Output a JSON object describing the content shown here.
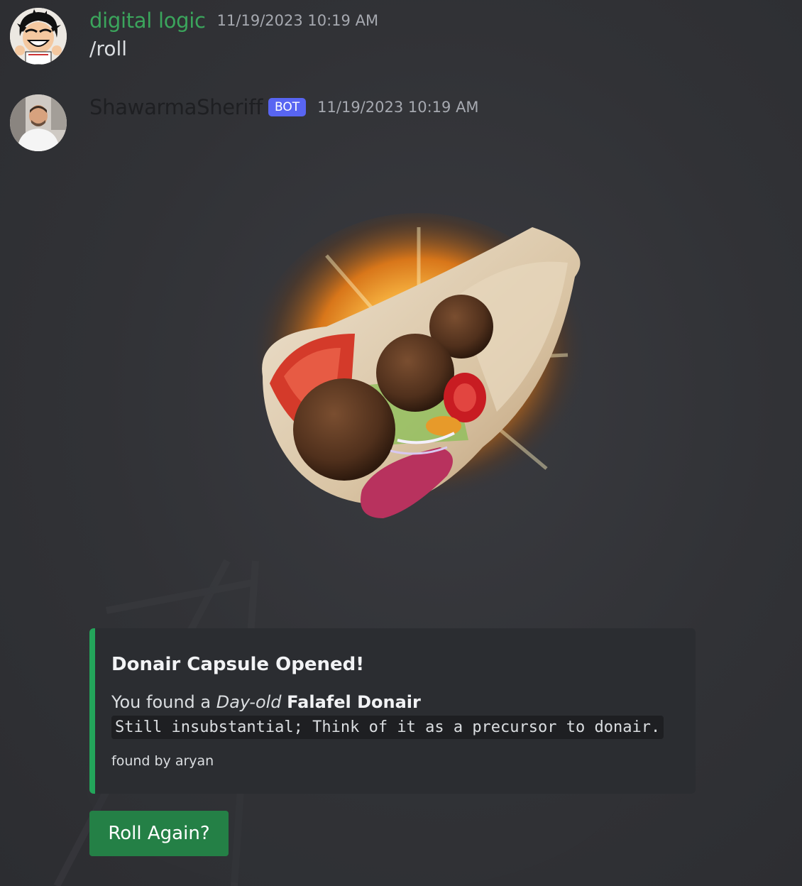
{
  "messages": [
    {
      "username": "digital logic",
      "username_color": "#3ba55c",
      "timestamp": "11/19/2023 10:19 AM",
      "content": "/roll",
      "avatar_icon": "anime-avatar"
    },
    {
      "username": "ShawarmaSheriff",
      "username_color": "#1e1f22",
      "badge": "BOT",
      "timestamp": "11/19/2023 10:19 AM",
      "avatar_icon": "person-avatar",
      "image_icon": "falafel-donair-image"
    }
  ],
  "embed": {
    "accent_color": "#23a55a",
    "title": "Donair Capsule Opened!",
    "desc_prefix": "You found a ",
    "desc_quality": "Day-old",
    "desc_item": "Falafel Donair",
    "code": "Still insubstantial; Think of it as a precursor to donair.",
    "footer": "found by aryan"
  },
  "button": {
    "label": "Roll Again?",
    "color": "#248046"
  }
}
